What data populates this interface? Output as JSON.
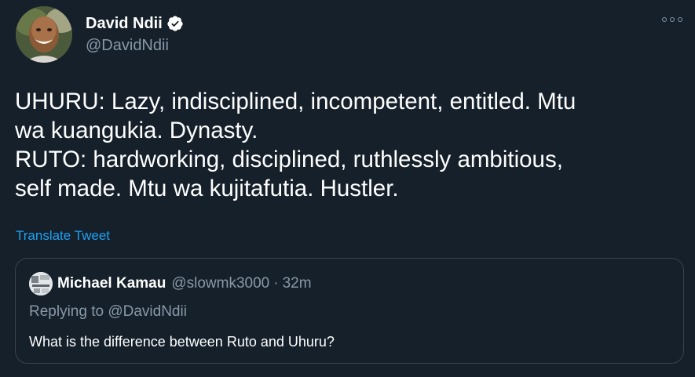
{
  "colors": {
    "background": "#15202b",
    "text_primary": "#ffffff",
    "text_secondary": "#8899a6",
    "link": "#1da1f2",
    "border": "#38444d"
  },
  "author": {
    "display_name": "David Ndii",
    "handle": "@DavidNdii",
    "verified": true,
    "avatar_icon": "profile-photo"
  },
  "more_menu": {
    "icon": "more-options-icon"
  },
  "tweet": {
    "lines": [
      "UHURU: Lazy, indisciplined, incompetent, entitled. Mtu",
      "wa kuangukia. Dynasty.",
      "RUTO: hardworking, disciplined, ruthlessly ambitious,",
      "self made. Mtu wa kujitafutia. Hustler."
    ],
    "translate_label": "Translate Tweet"
  },
  "quoted_tweet": {
    "display_name": "Michael Kamau",
    "handle": "@slowmk3000",
    "separator": "·",
    "time": "32m",
    "replying_to": "Replying to @DavidNdii",
    "text": "What is the difference between Ruto and Uhuru?"
  }
}
